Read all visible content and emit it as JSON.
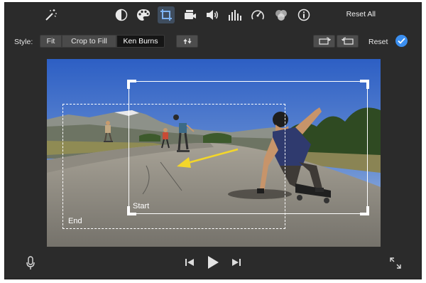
{
  "toolbar": {
    "icons": [
      "magic-wand-icon",
      "color-balance-icon",
      "color-palette-icon",
      "crop-icon",
      "camera-icon",
      "volume-icon",
      "equalizer-icon",
      "speedometer-icon",
      "filter-icon",
      "info-icon"
    ],
    "active_icon": "crop-icon",
    "reset_all_label": "Reset All"
  },
  "style_row": {
    "label": "Style:",
    "options": [
      "Fit",
      "Crop to Fill",
      "Ken Burns"
    ],
    "selected": "Ken Burns",
    "swap_icon": "swap-arrows-icon",
    "rotate_left_icon": "rotate-left-icon",
    "rotate_right_icon": "rotate-right-icon",
    "reset_label": "Reset",
    "apply_icon": "checkmark-icon"
  },
  "viewer": {
    "start_label": "Start",
    "end_label": "End"
  },
  "controls": {
    "mic_icon": "microphone-icon",
    "prev_icon": "skip-back-icon",
    "play_icon": "play-icon",
    "next_icon": "skip-forward-icon",
    "fullscreen_icon": "fullscreen-icon"
  },
  "colors": {
    "background": "#2b2b2b",
    "active_tool": "#3f4d5e",
    "accent_blue": "#3b8ff0",
    "arrow_yellow": "#f3d62a",
    "selected_segment": "#151515"
  }
}
